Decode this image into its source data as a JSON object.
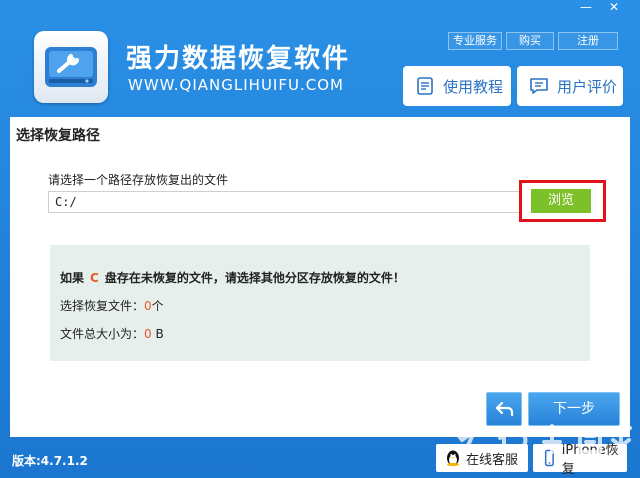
{
  "window": {
    "minimize_label": "—",
    "close_label": "✕"
  },
  "header": {
    "title": "强力数据恢复软件",
    "url": "WWW.QIANGLIHUIFU.COM",
    "top_links": [
      "专业服务",
      "购买",
      "注册"
    ],
    "tutorial_label": "使用教程",
    "review_label": "用户评价"
  },
  "main": {
    "section_title": "选择恢复路径",
    "path_label": "请选择一个路径存放恢复出的文件",
    "path_value": "C:/",
    "browse_label": "浏览",
    "warning_prefix": "如果",
    "warning_drive": "C",
    "warning_suffix": "盘存在未恢复的文件，请选择其他分区存放恢复的文件！",
    "selected_files_label": "选择恢复文件：",
    "selected_files_count": "0",
    "selected_files_unit": "个",
    "total_size_label": "文件总大小为：",
    "total_size_value": "0",
    "total_size_unit": "B",
    "next_label": "下一步"
  },
  "footer": {
    "version": "版本:4.7.1.2",
    "qq_label": "在线客服",
    "iphone_label": "iPhone恢复"
  },
  "colors": {
    "brand_blue": "#1e7fd6",
    "browse_green": "#7cc02a",
    "highlight_red": "#e1121c",
    "accent_orange": "#e55b2b"
  }
}
